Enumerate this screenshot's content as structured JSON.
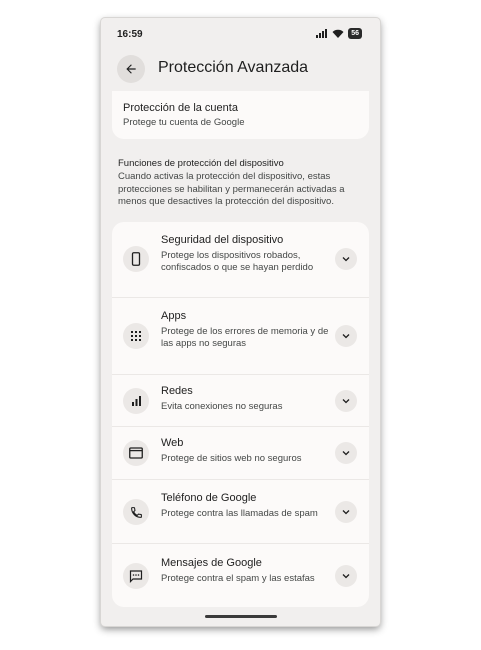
{
  "status_bar": {
    "time": "16:59",
    "battery": "56"
  },
  "app_bar": {
    "title": "Protección Avanzada"
  },
  "account": {
    "title": "Protección de la cuenta",
    "subtitle": "Protege tu cuenta de Google"
  },
  "section": {
    "heading": "Funciones de protección del dispositivo",
    "description": "Cuando activas la protección del dispositivo, estas protecciones se habilitan y permanecerán activadas a menos que desactives la protección del dispositivo."
  },
  "items": [
    {
      "icon": "phone-device-icon",
      "title": "Seguridad del dispositivo",
      "description": "Protege los dispositivos robados, confiscados o que se hayan perdido"
    },
    {
      "icon": "apps-grid-icon",
      "title": "Apps",
      "description": "Protege de los errores de memoria y de las apps no seguras"
    },
    {
      "icon": "signal-bars-icon",
      "title": "Redes",
      "description": "Evita conexiones no seguras"
    },
    {
      "icon": "browser-window-icon",
      "title": "Web",
      "description": "Protege de sitios web no seguros"
    },
    {
      "icon": "phone-call-icon",
      "title": "Teléfono de Google",
      "description": "Protege contra las llamadas de spam"
    },
    {
      "icon": "message-icon",
      "title": "Mensajes de Google",
      "description": "Protege contra el spam y las estafas"
    }
  ]
}
